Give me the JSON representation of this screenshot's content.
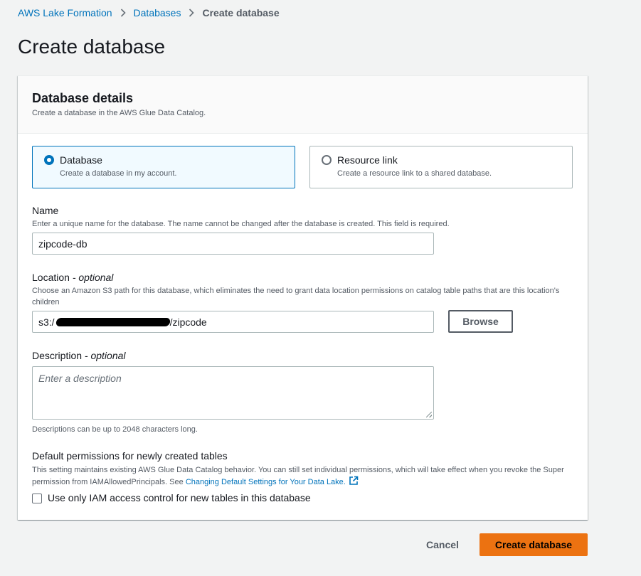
{
  "breadcrumb": {
    "items": [
      "AWS Lake Formation",
      "Databases"
    ],
    "current": "Create database"
  },
  "page": {
    "title": "Create database"
  },
  "panel": {
    "title": "Database details",
    "description": "Create a database in the AWS Glue Data Catalog."
  },
  "type_options": [
    {
      "label": "Database",
      "description": "Create a database in my account.",
      "selected": true
    },
    {
      "label": "Resource link",
      "description": "Create a resource link to a shared database.",
      "selected": false
    }
  ],
  "name_field": {
    "label": "Name",
    "description": "Enter a unique name for the database. The name cannot be changed after the database is created. This field is required.",
    "value": "zipcode-db"
  },
  "location_field": {
    "label": "Location",
    "label_suffix": " - optional",
    "description": "Choose an Amazon S3 path for this database, which eliminates the need to grant data location permissions on catalog table paths that are this location's children",
    "value_prefix": "s3:/",
    "value_suffix": "/zipcode",
    "browse_label": "Browse"
  },
  "description_field": {
    "label": "Description",
    "label_suffix": " - optional",
    "placeholder": "Enter a description",
    "hint": "Descriptions can be up to 2048 characters long."
  },
  "default_permissions": {
    "label": "Default permissions for newly created tables",
    "description": "This setting maintains existing AWS Glue Data Catalog behavior. You can still set individual permissions, which will take effect when you revoke the Super permission from IAMAllowedPrincipals. See ",
    "link_text": "Changing Default Settings for Your Data Lake.",
    "checkbox_label": "Use only IAM access control for new tables in this database",
    "checked": false
  },
  "footer": {
    "cancel_label": "Cancel",
    "submit_label": "Create database"
  },
  "colors": {
    "link": "#0073bb",
    "primary": "#ec7211",
    "selected_border": "#0073bb"
  }
}
